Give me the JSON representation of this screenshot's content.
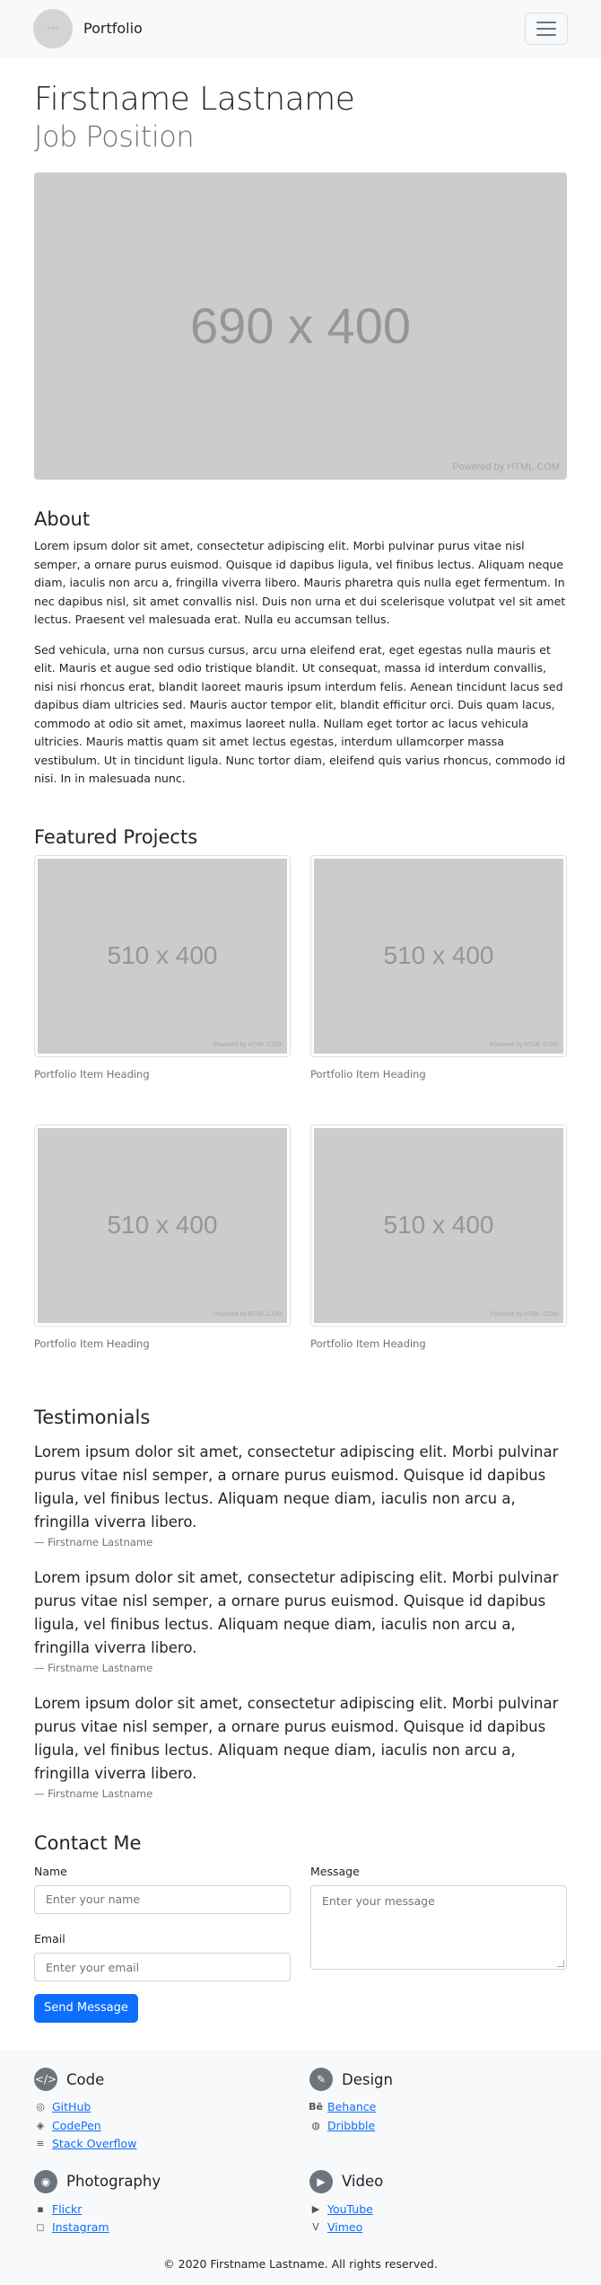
{
  "navbar": {
    "avatar_text": "◦–◦",
    "brand": "Portfolio"
  },
  "header": {
    "name": "Firstname Lastname",
    "job": "Job Position"
  },
  "hero": {
    "placeholder": "690 x 400",
    "powered": "Powered by HTML.COM"
  },
  "about": {
    "title": "About",
    "paragraphs": [
      "Lorem ipsum dolor sit amet, consectetur adipiscing elit. Morbi pulvinar purus vitae nisl semper, a ornare purus euismod. Quisque id dapibus ligula, vel finibus lectus. Aliquam neque diam, iaculis non arcu a, fringilla viverra libero. Mauris pharetra quis nulla eget fermentum. In nec dapibus nisl, sit amet convallis nisl. Duis non urna et dui scelerisque volutpat vel sit amet lectus. Praesent vel malesuada erat. Nulla eu accumsan tellus.",
      "Sed vehicula, urna non cursus cursus, arcu urna eleifend erat, eget egestas nulla mauris et elit. Mauris et augue sed odio tristique blandit. Ut consequat, massa id interdum convallis, nisi nisi rhoncus erat, blandit laoreet mauris ipsum interdum felis. Aenean tincidunt lacus sed dapibus diam ultricies sed. Mauris auctor tempor elit, blandit efficitur orci. Duis quam lacus, commodo at odio sit amet, maximus laoreet nulla. Nullam eget tortor ac lacus vehicula ultricies. Mauris mattis quam sit amet lectus egestas, interdum ullamcorper massa vestibulum. Ut in tincidunt ligula. Nunc tortor diam, eleifend quis varius rhoncus, commodo id nisi. In in malesuada nunc."
    ]
  },
  "projects": {
    "title": "Featured Projects",
    "items": [
      {
        "placeholder": "510 x 400",
        "powered": "Powered by HTML.COM",
        "caption": "Portfolio Item Heading"
      },
      {
        "placeholder": "510 x 400",
        "powered": "Powered by HTML.COM",
        "caption": "Portfolio Item Heading"
      },
      {
        "placeholder": "510 x 400",
        "powered": "Powered by HTML.COM",
        "caption": "Portfolio Item Heading"
      },
      {
        "placeholder": "510 x 400",
        "powered": "Powered by HTML.COM",
        "caption": "Portfolio Item Heading"
      }
    ]
  },
  "testimonials": {
    "title": "Testimonials",
    "items": [
      {
        "text": "Lorem ipsum dolor sit amet, consectetur adipiscing elit. Morbi pulvinar purus vitae nisl semper, a ornare purus euismod. Quisque id dapibus ligula, vel finibus lectus. Aliquam neque diam, iaculis non arcu a, fringilla viverra libero.",
        "author": "— Firstname Lastname"
      },
      {
        "text": "Lorem ipsum dolor sit amet, consectetur adipiscing elit. Morbi pulvinar purus vitae nisl semper, a ornare purus euismod. Quisque id dapibus ligula, vel finibus lectus. Aliquam neque diam, iaculis non arcu a, fringilla viverra libero.",
        "author": "— Firstname Lastname"
      },
      {
        "text": "Lorem ipsum dolor sit amet, consectetur adipiscing elit. Morbi pulvinar purus vitae nisl semper, a ornare purus euismod. Quisque id dapibus ligula, vel finibus lectus. Aliquam neque diam, iaculis non arcu a, fringilla viverra libero.",
        "author": "— Firstname Lastname"
      }
    ]
  },
  "contact": {
    "title": "Contact Me",
    "name_label": "Name",
    "name_placeholder": "Enter your name",
    "email_label": "Email",
    "email_placeholder": "Enter your email",
    "message_label": "Message",
    "message_placeholder": "Enter your message",
    "submit": "Send Message"
  },
  "footer": {
    "code": {
      "title": "Code",
      "links": [
        "GitHub",
        "CodePen",
        "Stack Overflow"
      ]
    },
    "design": {
      "title": "Design",
      "links": [
        "Behance",
        "Dribbble"
      ]
    },
    "photography": {
      "title": "Photography",
      "links": [
        "Flickr",
        "Instagram"
      ]
    },
    "video": {
      "title": "Video",
      "links": [
        "YouTube",
        "Vimeo"
      ]
    },
    "copyright": "© 2020 Firstname Lastname. All rights reserved."
  },
  "colors": {
    "accent": "#0d6efd",
    "muted": "#6c757d",
    "placeholder_bg": "#cccccc",
    "footer_bg": "#f8f9fa"
  }
}
